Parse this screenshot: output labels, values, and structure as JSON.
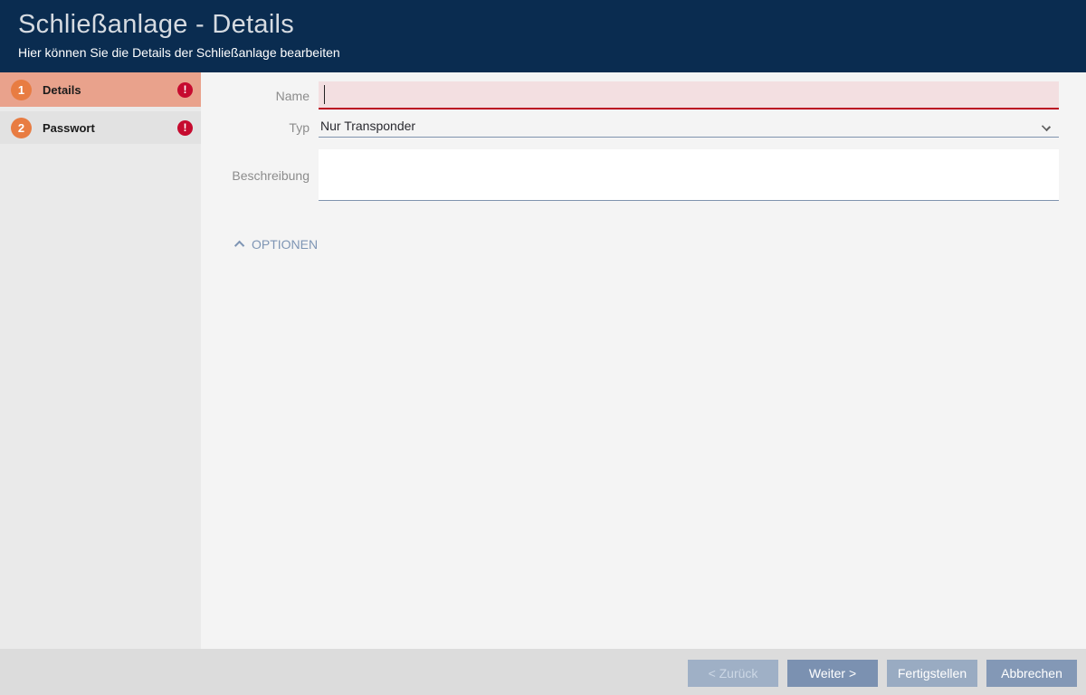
{
  "header": {
    "title": "Schließanlage - Details",
    "subtitle": "Hier können Sie die Details der Schließanlage bearbeiten"
  },
  "sidebar": {
    "steps": [
      {
        "number": "1",
        "label": "Details",
        "active": true,
        "has_error": true
      },
      {
        "number": "2",
        "label": "Passwort",
        "active": false,
        "has_error": true
      }
    ]
  },
  "icons": {
    "error_glyph": "!",
    "typ_chevron": "chevron-down",
    "options_chevron": "chevron-up"
  },
  "form": {
    "name": {
      "label": "Name",
      "value": "",
      "state": "invalid-empty-focused"
    },
    "typ": {
      "label": "Typ",
      "value": "Nur Transponder"
    },
    "beschreibung": {
      "label": "Beschreibung",
      "value": ""
    },
    "options_toggle": {
      "label": "OPTIONEN",
      "expanded": true
    }
  },
  "footer": {
    "back": "< Zurück",
    "next": "Weiter >",
    "finish": "Fertigstellen",
    "cancel": "Abbrechen"
  },
  "colors": {
    "header_bg": "#0a2c50",
    "active_step_bg": "#e9a28c",
    "step_number_bg": "#e87c42",
    "error_red": "#c60b2f",
    "invalid_field_bg": "#f3dfe1",
    "invalid_field_border": "#bb0a21",
    "field_underline": "#8093ae",
    "options_text": "#7e95b4",
    "primary_button_bg": "#7b91b1"
  }
}
